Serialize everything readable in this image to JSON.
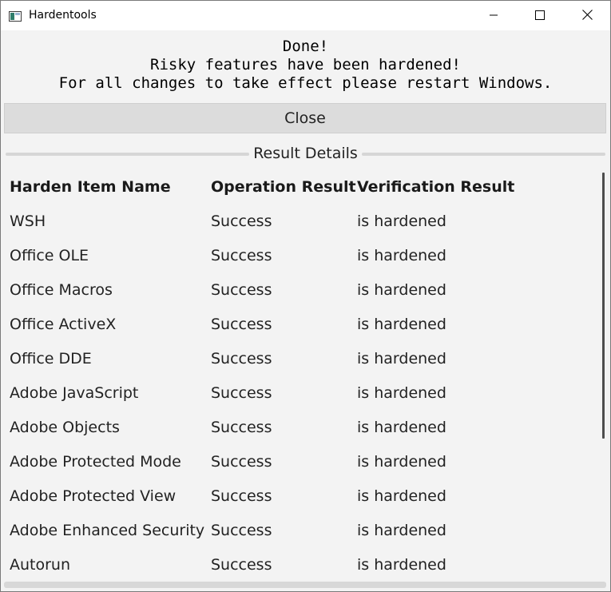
{
  "window": {
    "title": "Hardentools",
    "app_icon": "window-app-icon",
    "controls": {
      "minimize_icon": "minimize-icon",
      "maximize_icon": "maximize-icon",
      "close_icon": "close-icon"
    }
  },
  "status": {
    "line1": "Done!",
    "line2": "Risky features have been hardened!",
    "line3": "For all changes to take effect please restart Windows."
  },
  "close_button": {
    "label": "Close"
  },
  "result_details": {
    "title": "Result Details",
    "columns": [
      "Harden Item Name",
      "Operation Result",
      "Verification Result"
    ],
    "rows": [
      [
        "WSH",
        "Success",
        "is hardened"
      ],
      [
        "Office OLE",
        "Success",
        "is hardened"
      ],
      [
        "Office Macros",
        "Success",
        "is hardened"
      ],
      [
        "Office ActiveX",
        "Success",
        "is hardened"
      ],
      [
        "Office DDE",
        "Success",
        "is hardened"
      ],
      [
        "Adobe JavaScript",
        "Success",
        "is hardened"
      ],
      [
        "Adobe Objects",
        "Success",
        "is hardened"
      ],
      [
        "Adobe Protected Mode",
        "Success",
        "is hardened"
      ],
      [
        "Adobe Protected View",
        "Success",
        "is hardened"
      ],
      [
        "Adobe Enhanced Security",
        "Success",
        "is hardened"
      ],
      [
        "Autorun",
        "Success",
        "is hardened"
      ]
    ]
  },
  "colors": {
    "window_background": "#f3f3f3",
    "titlebar_background": "#ffffff",
    "button_background": "#dcdcdc",
    "text": "#222222"
  }
}
